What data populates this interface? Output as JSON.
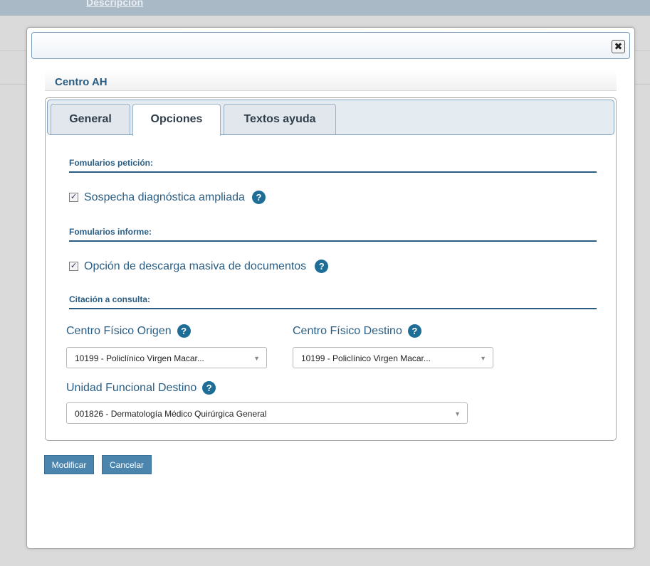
{
  "background": {
    "top_link": "Descripción"
  },
  "modal": {
    "close_symbol": "✖",
    "section_title": "Centro AH",
    "tabs": [
      {
        "label": "General",
        "active": false
      },
      {
        "label": "Opciones",
        "active": true
      },
      {
        "label": "Textos ayuda",
        "active": false
      }
    ],
    "groups": {
      "formularios_peticion": {
        "heading": "Fomularios petición:",
        "checkbox_label": "Sospecha diagnóstica ampliada",
        "checked": true
      },
      "formularios_informe": {
        "heading": "Fomularios informe:",
        "checkbox_label": "Opción de descarga masiva de documentos",
        "checked": true
      },
      "citacion": {
        "heading": "Citación a consulta:",
        "origen_label": "Centro Físico Origen",
        "origen_value": "10199 - Policlínico Virgen Macar...",
        "destino_label": "Centro Físico Destino",
        "destino_value": "10199 - Policlínico Virgen Macar...",
        "unidad_label": "Unidad Funcional Destino",
        "unidad_value": "001826 - Dermatología Médico Quirúrgica General"
      }
    },
    "help_symbol": "?",
    "check_symbol": "✓",
    "dropdown_symbol": "▼",
    "buttons": {
      "modificar": "Modificar",
      "cancelar": "Cancelar"
    }
  },
  "colors": {
    "accent": "#2a5d84",
    "help_icon": "#1e6d96",
    "button": "#4b85ae"
  }
}
